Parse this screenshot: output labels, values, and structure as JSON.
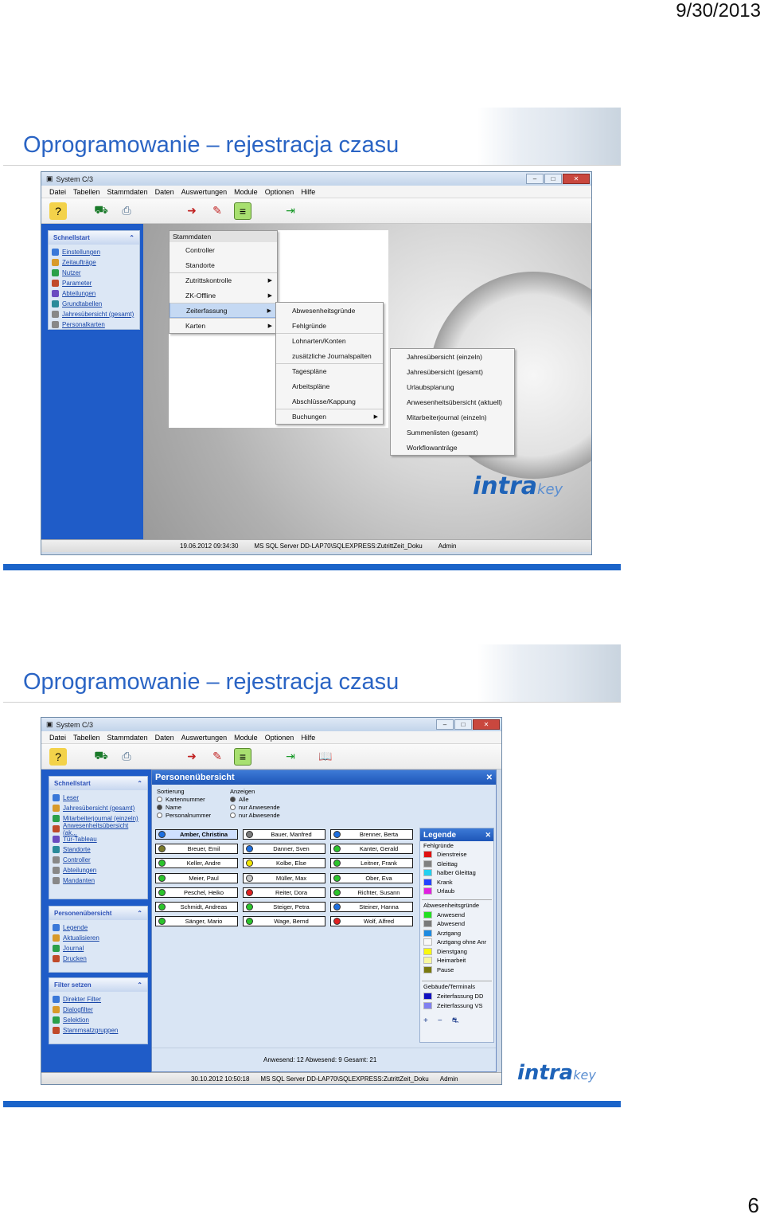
{
  "date": "9/30/2013",
  "page_number": "6",
  "slide1": {
    "title": "Oprogramowanie – rejestracja czasu",
    "window_title": "System C/3",
    "menu": [
      "Datei",
      "Tabellen",
      "Stammdaten",
      "Daten",
      "Auswertungen",
      "Module",
      "Optionen",
      "Hilfe"
    ],
    "schnellstart": {
      "header": "Schnellstart",
      "items": [
        "Einstellungen",
        "Zeitaufträge",
        "Nutzer",
        "Parameter",
        "Abteilungen",
        "Grundtabellen",
        "Jahresübersicht (gesamt)",
        "Personalkarten"
      ]
    },
    "stammdaten_menu": {
      "header": "Stammdaten",
      "items": [
        "Controller",
        "Standorte",
        "Zutrittskontrolle",
        "ZK-Offline",
        "Zeiterfassung",
        "Karten"
      ]
    },
    "zeiterfassung_menu": [
      "Abwesenheitsgründe",
      "Fehlgründe",
      "Lohnarten/Konten",
      "zusätzliche Journalspalten",
      "Tagespläne",
      "Arbeitspläne",
      "Abschlüsse/Kappung",
      "Buchungen"
    ],
    "buchungen_menu": [
      "Jahresübersicht (einzeln)",
      "Jahresübersicht (gesamt)",
      "Urlaubsplanung",
      "Anwesenheitsübersicht (aktuell)",
      "Mitarbeiterjournal (einzeln)",
      "Summenlisten (gesamt)",
      "Workflowanträge"
    ],
    "status": {
      "datetime": "19.06.2012 09:34:30",
      "db": "MS SQL Server DD-LAP70\\SQLEXPRESS:ZutrittZeit_Doku",
      "user": "Admin"
    },
    "logo_main": "intra",
    "logo_suffix": "key"
  },
  "slide2": {
    "title": "Oprogramowanie – rejestracja czasu",
    "window_title": "System C/3",
    "menu": [
      "Datei",
      "Tabellen",
      "Stammdaten",
      "Daten",
      "Auswertungen",
      "Module",
      "Optionen",
      "Hilfe"
    ],
    "schnellstart": {
      "header": "Schnellstart",
      "items": [
        "Leser",
        "Jahresübersicht (gesamt)",
        "Mitarbeiterjournal (einzeln)",
        "Anwesenheitsübersicht (ak...",
        "Tür-Tableau",
        "Standorte",
        "Controller",
        "Abteilungen",
        "Mandanten"
      ]
    },
    "personenuebersicht_panel": {
      "header": "Personenübersicht",
      "items": [
        "Legende",
        "Aktualisieren",
        "Journal",
        "Drucken"
      ]
    },
    "filter_panel": {
      "header": "Filter setzen",
      "items": [
        "Direkter Filter",
        "Dialogfilter",
        "Selektion",
        "Stammsatzgruppen"
      ]
    },
    "overview": {
      "title": "Personenübersicht",
      "sort_label": "Sortierung",
      "sort_options": [
        "Kartennummer",
        "Name",
        "Personalnummer"
      ],
      "sort_selected": "Name",
      "show_label": "Anzeigen",
      "show_options": [
        "Alle",
        "nur Anwesende",
        "nur Abwesende"
      ],
      "show_selected": "Alle",
      "employees": [
        {
          "name": "Amber, Christina",
          "color": "#1e6fe0",
          "selected": true
        },
        {
          "name": "Bauer, Manfred",
          "color": "#7a7a7a"
        },
        {
          "name": "Brenner, Berta",
          "color": "#1e6fe0"
        },
        {
          "name": "Breuer, Emil",
          "color": "#7a7a2a"
        },
        {
          "name": "Danner, Sven",
          "color": "#1e6fe0"
        },
        {
          "name": "Kanter, Gerald",
          "color": "#2bc42b"
        },
        {
          "name": "Keller, Andre",
          "color": "#2bc42b"
        },
        {
          "name": "Kolbe, Else",
          "color": "#f2e600"
        },
        {
          "name": "Leitner, Frank",
          "color": "#2bc42b"
        },
        {
          "name": "Meier, Paul",
          "color": "#2bc42b"
        },
        {
          "name": "Müller, Max",
          "color": "#c8c8c8"
        },
        {
          "name": "Ober, Eva",
          "color": "#2bc42b"
        },
        {
          "name": "Peschel, Heiko",
          "color": "#2bc42b"
        },
        {
          "name": "Reiter, Dora",
          "color": "#e02020"
        },
        {
          "name": "Richter, Susann",
          "color": "#2bc42b"
        },
        {
          "name": "Schmidt, Andreas",
          "color": "#2bc42b"
        },
        {
          "name": "Steiger, Petra",
          "color": "#2bc42b"
        },
        {
          "name": "Steiner, Hanna",
          "color": "#1e6fe0"
        },
        {
          "name": "Sänger, Mario",
          "color": "#2bc42b"
        },
        {
          "name": "Wage, Bernd",
          "color": "#2bc42b"
        },
        {
          "name": "Wolf, Alfred",
          "color": "#e02020"
        }
      ],
      "summary": "Anwesend: 12   Abwesend: 9   Gesamt: 21"
    },
    "legend": {
      "title": "Legende",
      "fehl_title": "Fehlgründe",
      "fehl": [
        {
          "label": "Dienstreise",
          "color": "#e01010"
        },
        {
          "label": "Gleittag",
          "color": "#808080"
        },
        {
          "label": "halber Gleittag",
          "color": "#22d0f0"
        },
        {
          "label": "Krank",
          "color": "#2244ff"
        },
        {
          "label": "Urlaub",
          "color": "#e020e0"
        }
      ],
      "abw_title": "Abwesenheitsgründe",
      "abw": [
        {
          "label": "Anwesend",
          "color": "#22e022"
        },
        {
          "label": "Abwesend",
          "color": "#7a7a7a"
        },
        {
          "label": "Arztgang",
          "color": "#1e8ae0"
        },
        {
          "label": "Arztgang ohne Anr",
          "color": "#f8f8f8"
        },
        {
          "label": "Dienstgang",
          "color": "#f8f810"
        },
        {
          "label": "Heimarbeit",
          "color": "#f8f8a0"
        },
        {
          "label": "Pause",
          "color": "#7a7a10"
        }
      ],
      "geb_title": "Gebäude/Terminals",
      "geb": [
        {
          "label": "Zeiterfassung DD",
          "color": "#1010c0"
        },
        {
          "label": "Zeiterfassung VS",
          "color": "#8080f0"
        }
      ]
    },
    "status": {
      "datetime": "30.10.2012 10:50:18",
      "db": "MS SQL Server DD-LAP70\\SQLEXPRESS:ZutrittZeit_Doku",
      "user": "Admin"
    },
    "logo_main": "intra",
    "logo_suffix": "key"
  }
}
